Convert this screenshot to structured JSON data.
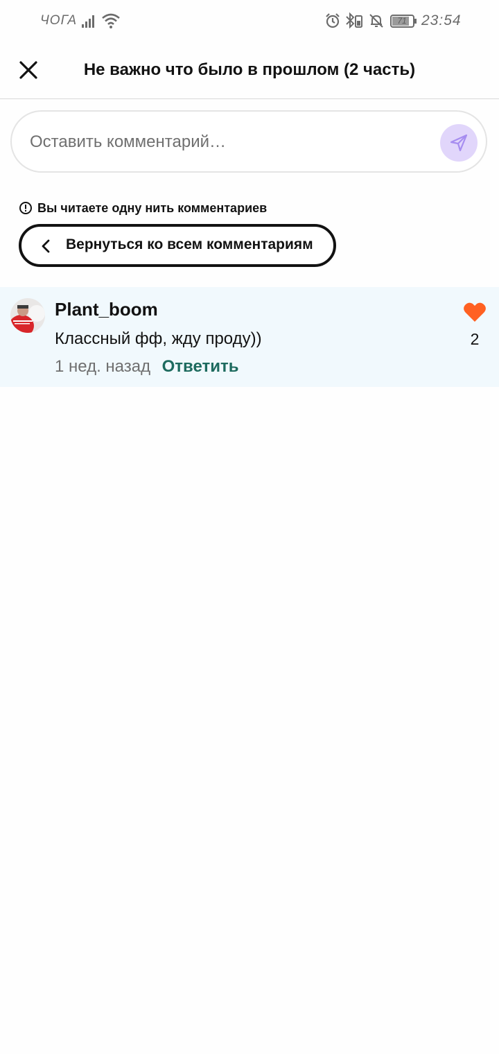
{
  "status_bar": {
    "carrier": "ЧОГА",
    "battery_level": "71",
    "time": "23:54"
  },
  "header": {
    "title": "Не важно что было в прошлом (2 часть)",
    "close_icon": "close-icon"
  },
  "comment_box": {
    "placeholder": "Оставить комментарий…",
    "value": "",
    "send_icon": "send-icon",
    "send_button_color": "#e1d6fb"
  },
  "thread_notice": {
    "text": "Вы читаете одну нить комментариев",
    "icon": "info-icon"
  },
  "back_button": {
    "label": "Вернуться ко всем комментариям",
    "icon": "chevron-left-icon"
  },
  "comments": [
    {
      "username": "Plant_boom",
      "text": "Классный фф, жду проду))",
      "timestamp": "1 нед. назад",
      "reply_label": "Ответить",
      "likes": "2",
      "liked": true,
      "like_color": "#ff6122",
      "row_background": "#f1f9fd"
    }
  ],
  "colors": {
    "accent_reply": "#1e6b5f",
    "heart": "#ff6122",
    "text_primary": "#121212",
    "text_secondary": "#6f6f6f"
  }
}
